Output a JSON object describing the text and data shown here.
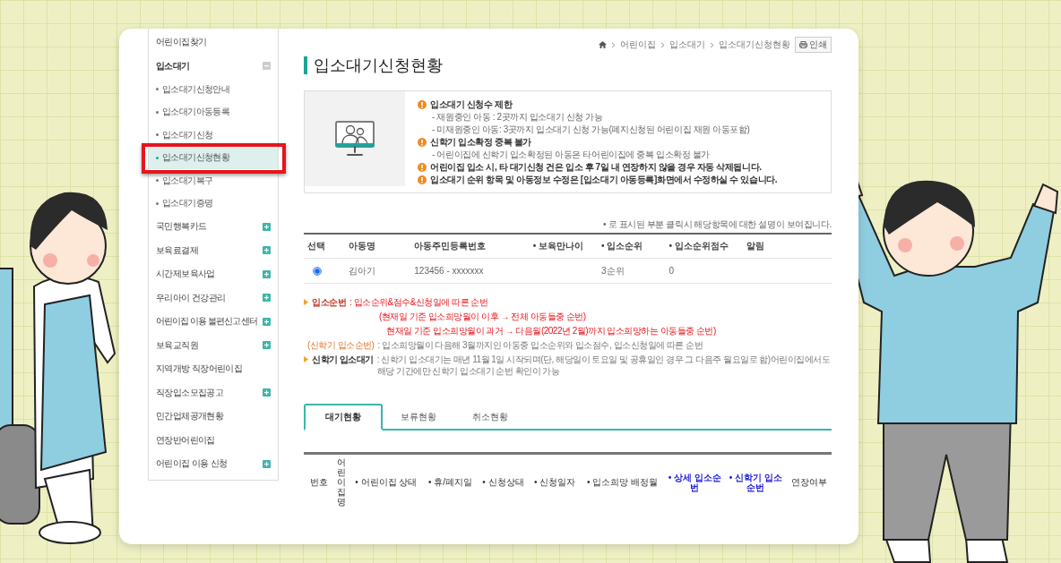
{
  "sidebar": {
    "items": [
      {
        "label": "어린이집찾기",
        "kind": "link"
      },
      {
        "label": "입소대기",
        "kind": "group",
        "expanded": true,
        "children": [
          {
            "label": "입소대기신청안내",
            "selected": false
          },
          {
            "label": "입소대기아동등록",
            "selected": false
          },
          {
            "label": "입소대기신청",
            "selected": false
          },
          {
            "label": "입소대기신청현황",
            "selected": true
          },
          {
            "label": "입소대기복구",
            "selected": false
          },
          {
            "label": "입소대기증명",
            "selected": false
          }
        ]
      },
      {
        "label": "국민행복카드",
        "kind": "group",
        "expanded": false
      },
      {
        "label": "보육료결제",
        "kind": "group",
        "expanded": false
      },
      {
        "label": "시간제보육사업",
        "kind": "group",
        "expanded": false
      },
      {
        "label": "우리아이 건강관리",
        "kind": "group",
        "expanded": false
      },
      {
        "label": "어린이집 이용 불편신고 센터",
        "kind": "group",
        "expanded": false
      },
      {
        "label": "보육교직원",
        "kind": "group",
        "expanded": false
      },
      {
        "label": "지역개방 직장어린이집",
        "kind": "link"
      },
      {
        "label": "직장입소모집공고",
        "kind": "group",
        "expanded": false
      },
      {
        "label": "민간업체공개현황",
        "kind": "link"
      },
      {
        "label": "연장반어린이집",
        "kind": "link"
      },
      {
        "label": "어린이집 이용 신청",
        "kind": "group",
        "expanded": false
      }
    ]
  },
  "breadcrumb": {
    "items": [
      "어린이집",
      "입소대기",
      "입소대기신청현황"
    ],
    "print_button": "인쇄"
  },
  "page_title": "입소대기신청현황",
  "notice": {
    "items": [
      {
        "kind": "heading",
        "text": "입소대기 신청수 제한"
      },
      {
        "kind": "detail",
        "text": "- 재원중인 아동 : 2곳까지 입소대기 신청 가능"
      },
      {
        "kind": "detail",
        "text": "- 미재원중인 아동: 3곳까지 입소대기 신청 가능(폐지신청된 어린이집 재원 아동포함)"
      },
      {
        "kind": "heading",
        "text": "신학기 입소확정 중복 불가"
      },
      {
        "kind": "detail",
        "text": "- 어린이집에 신학기 입소확정된 아동은 타어린이집에 중복 입소확정 불가"
      },
      {
        "kind": "heading",
        "text": "어린이집 입소 시, 타 대기신청 건은 입소 후 7일 내 연장하지 않을 경우 자동 삭제됩니다."
      },
      {
        "kind": "heading",
        "text": "입소대기 순위 항목 및 아동정보 수정은 [입소대기 아동등록]화면에서 수정하실 수 있습니다."
      }
    ]
  },
  "help_note": "• 로 표시된 부분 클릭시 해당항목에 대한 설명이 보여집니다.",
  "applicant_table": {
    "columns": [
      "선택",
      "아동명",
      "아동주민등록번호",
      "• 보육만나이",
      "• 입소순위",
      "• 입소순위점수",
      "알림"
    ],
    "rows": [
      {
        "selected": true,
        "child_name": "김아기",
        "resident_number": "123456 - xxxxxxx",
        "priority": "3순위",
        "priority_score": "0"
      }
    ]
  },
  "notes": [
    {
      "kind": "main",
      "emphasis": true,
      "label": "입소순번",
      "text": ": 입소순위&점수&신청일에 따른 순번",
      "lines": [
        "(현재일 기준 입소희망월이 이후 → 전체 아동들중 순번)",
        "현재일 기준 입소희망월이 과거 → 다음월(2022년 2월)까지 입소희망하는 아동들중 순번)"
      ]
    },
    {
      "kind": "aside",
      "emphasis": false,
      "label": "(신학기 입소순번)",
      "text": ": 입소희망월이 다음해 3월까지인 아동중 입소순위와 입소점수, 입소신청일에 따른 순번"
    },
    {
      "kind": "main",
      "emphasis": false,
      "label": "신학기 입소대기",
      "text": ": 신학기 입소대기는 매년 11월 1일 시작되며(단, 해당일이 토요일 및 공휴일인 경우 그 다음주 월요일로 함)어린이집에서도 해당 기간에만 신학기 입소대기 순번 확인이 가능"
    }
  ],
  "tabs": [
    {
      "label": "대기현황",
      "selected": true
    },
    {
      "label": "보류현황",
      "selected": false
    },
    {
      "label": "취소현황",
      "selected": false
    }
  ],
  "status_table": {
    "columns": [
      {
        "label": "번호",
        "kind": "plain"
      },
      {
        "label": "어린이집명",
        "kind": "vertical"
      },
      {
        "label": "• 어린이집 상태",
        "kind": "plain"
      },
      {
        "label": "• 휴/폐지일",
        "kind": "plain"
      },
      {
        "label": "• 신청상태",
        "kind": "plain"
      },
      {
        "label": "• 신청일자",
        "kind": "plain"
      },
      {
        "label": "• 입소희망 배정월",
        "kind": "plain"
      },
      {
        "label": "• 상세 입소순번",
        "kind": "link"
      },
      {
        "label": "• 신학기 입소순번",
        "kind": "link"
      },
      {
        "label": "연장여부",
        "kind": "plain"
      }
    ]
  }
}
